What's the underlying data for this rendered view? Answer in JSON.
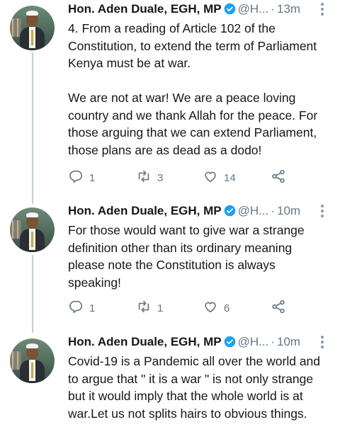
{
  "tweets": [
    {
      "name": "Hon. Aden Duale, EGH, MP",
      "handle": "@H...",
      "time": "13m",
      "text": "4. From a reading of Article 102 of the\nConstitution, to extend the term of Parliament\nKenya must be at war.\n\nWe are not at war! We are a peace loving\ncountry and we thank Allah for the peace. For\nthose arguing that we can extend Parliament,\nthose plans are as dead as a dodo!",
      "replies": "1",
      "retweets": "3",
      "likes": "14"
    },
    {
      "name": "Hon. Aden Duale, EGH, MP",
      "handle": "@H...",
      "time": "10m",
      "text": "For those would want to give war a strange\ndefinition other than its ordinary meaning\nplease note the Constitution is always\nspeaking!",
      "replies": "1",
      "retweets": "1",
      "likes": "6"
    },
    {
      "name": "Hon. Aden Duale, EGH, MP",
      "handle": "@H...",
      "time": "10m",
      "text": "Covid-19 is a Pandemic all over the world and\nto argue that \" it is a war \" is not only strange\nbut it would imply that the whole world is at\nwar.Let us not splits hairs to obvious things.",
      "replies": "",
      "retweets": "",
      "likes": ""
    }
  ],
  "colors": {
    "verified": "#1da1f2",
    "muted": "#657786",
    "thread_line": "#c4cfd6"
  },
  "icons": [
    "verified-badge-icon",
    "reply-icon",
    "retweet-icon",
    "like-icon",
    "share-icon",
    "more-icon"
  ]
}
